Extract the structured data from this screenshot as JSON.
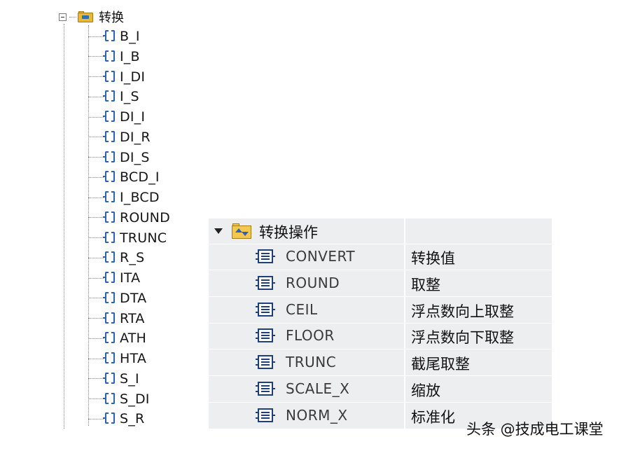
{
  "tree": {
    "root_label": "转换",
    "items": [
      "B_I",
      "I_B",
      "I_DI",
      "I_S",
      "DI_I",
      "DI_R",
      "DI_S",
      "BCD_I",
      "I_BCD",
      "ROUND",
      "TRUNC",
      "R_S",
      "ITA",
      "DTA",
      "RTA",
      "ATH",
      "HTA",
      "S_I",
      "S_DI",
      "S_R"
    ]
  },
  "table": {
    "header_label": "转换操作",
    "rows": [
      {
        "name": "CONVERT",
        "desc": "转换值"
      },
      {
        "name": "ROUND",
        "desc": "取整"
      },
      {
        "name": "CEIL",
        "desc": "浮点数向上取整"
      },
      {
        "name": "FLOOR",
        "desc": "浮点数向下取整"
      },
      {
        "name": "TRUNC",
        "desc": "截尾取整"
      },
      {
        "name": "SCALE_X",
        "desc": "缩放"
      },
      {
        "name": "NORM_X",
        "desc": "标准化"
      }
    ]
  },
  "watermark": "头条 @技成电工课堂",
  "colors": {
    "table_bg": "#eceef0",
    "icon_blue": "#2a63b8",
    "folder_yellow": "#e9b935"
  }
}
